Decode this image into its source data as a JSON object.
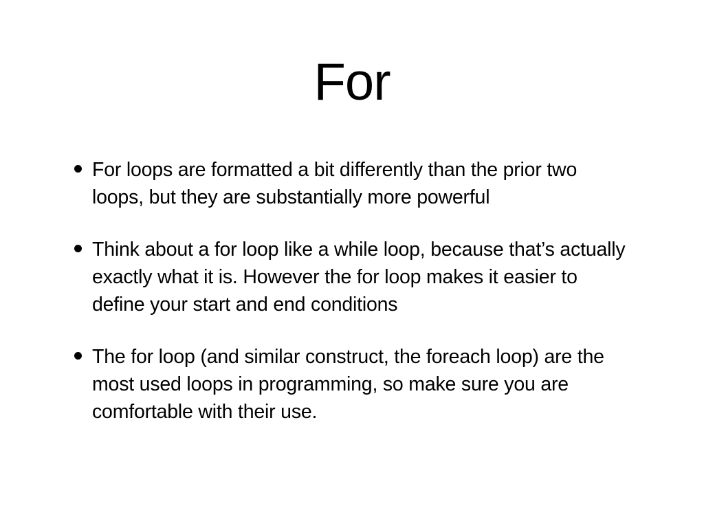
{
  "slide": {
    "title": "For",
    "bullets": [
      "For loops are formatted a bit differently than the prior two loops, but they are substantially more powerful",
      "Think about a for loop like a while loop, because that’s actually exactly what it is. However the for loop makes it easier to define your start and end conditions",
      "The for loop (and similar construct, the foreach loop) are the most used loops in programming, so make sure you are comfortable with their use."
    ]
  },
  "colors": {
    "background": "#ffffff",
    "text": "#000000"
  },
  "icons": {
    "bullet": "bullet-dot-icon"
  }
}
